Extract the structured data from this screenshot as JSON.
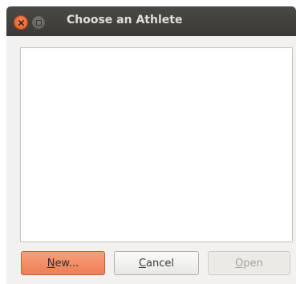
{
  "window": {
    "title": "Choose an Athlete"
  },
  "buttons": {
    "new": {
      "mnemonic": "N",
      "rest": "ew..."
    },
    "cancel": {
      "mnemonic": "C",
      "rest": "ancel"
    },
    "open": {
      "mnemonic": "O",
      "rest": "pen",
      "enabled": false
    }
  },
  "colors": {
    "titlebar": "#3f3e3a",
    "close": "#e8673a",
    "primary_button": "#f29068",
    "window_bg": "#f2f1f0"
  },
  "icons": {
    "close": "close-icon",
    "maximize": "maximize-icon"
  }
}
